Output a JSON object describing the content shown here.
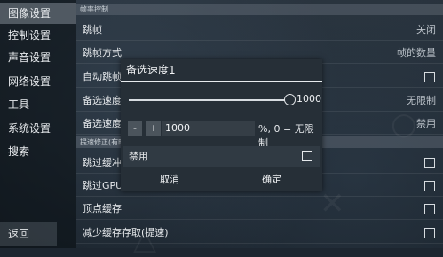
{
  "sidebar": {
    "items": [
      {
        "label": "图像设置",
        "active": true
      },
      {
        "label": "控制设置"
      },
      {
        "label": "声音设置"
      },
      {
        "label": "网络设置"
      },
      {
        "label": "工具"
      },
      {
        "label": "系统设置"
      },
      {
        "label": "搜索"
      }
    ],
    "back_label": "返回"
  },
  "main": {
    "section1_header": "帧率控制",
    "rows1": [
      {
        "label": "跳帧",
        "value": "关闭"
      },
      {
        "label": "跳帧方式",
        "value": "帧的数量"
      },
      {
        "label": "自动跳帧",
        "checkbox": true
      },
      {
        "label": "备选速度1",
        "value": "无限制"
      },
      {
        "label": "备选速度2",
        "value": "禁用"
      }
    ],
    "section2_header": "提速修正(有时",
    "rows2": [
      {
        "label": "跳过缓冲",
        "checkbox": true
      },
      {
        "label": "跳过GPU模块",
        "checkbox": true
      },
      {
        "label": "顶点缓存",
        "checkbox": true
      },
      {
        "label": "减少缓存存取(提速)",
        "checkbox": true
      }
    ]
  },
  "dialog": {
    "title": "备选速度1",
    "slider_value": "1000",
    "slider_fraction": 1.0,
    "minus_label": "-",
    "plus_label": "+",
    "input_value": "1000",
    "input_hint": "%, 0 = 无限制",
    "toggle_label": "禁用",
    "cancel_label": "取消",
    "ok_label": "确定"
  }
}
